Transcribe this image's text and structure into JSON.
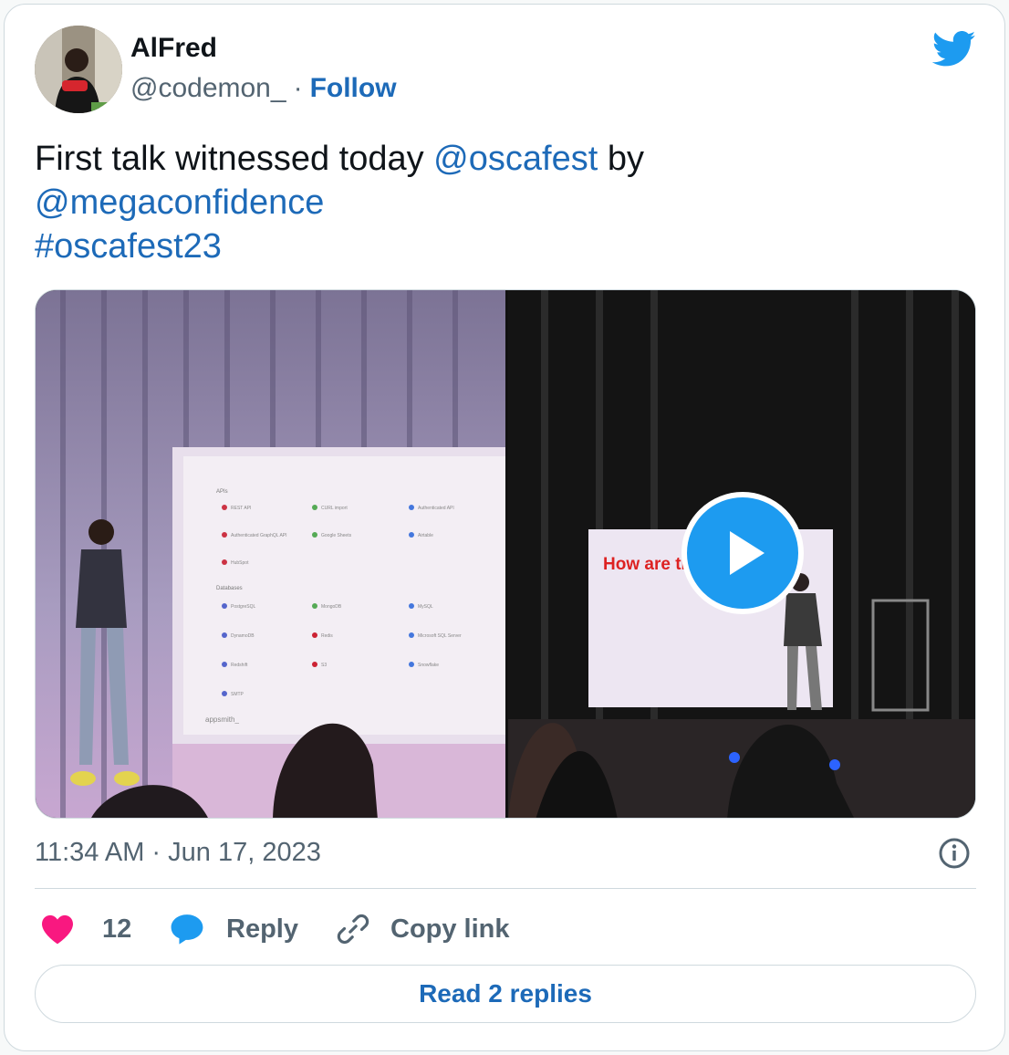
{
  "author": {
    "name": "AlFred",
    "handle": "@codemon_",
    "separator": "·",
    "follow_label": "Follow"
  },
  "tweet": {
    "text_1": "First talk witnessed today ",
    "mention_1": "@oscafest",
    "text_2": " by",
    "mention_2": "@megaconfidence",
    "hashtag": "#oscafest23"
  },
  "media": {
    "left_slide": {
      "section_apis": "APIs",
      "section_databases": "Databases",
      "items": [
        "REST API",
        "CURL import",
        "Authenticated API",
        "Authenticated GraphQL API",
        "Google Sheets",
        "Airtable",
        "HubSpot",
        "PostgreSQL",
        "MongoDB",
        "MySQL",
        "DynamoDB",
        "Redis",
        "Microsoft SQL Server",
        "Redshift",
        "S3",
        "Snowflake",
        "SMTP"
      ],
      "footer": "appsmith_"
    },
    "right_slide": {
      "headline": "How are th"
    },
    "play_icon": "play-icon"
  },
  "meta": {
    "timestamp": "11:34 AM · Jun 17, 2023"
  },
  "actions": {
    "like_count": "12",
    "reply_label": "Reply",
    "copy_link_label": "Copy link"
  },
  "footer": {
    "read_replies_label": "Read 2 replies"
  },
  "colors": {
    "link": "#1d6ab8",
    "twitter_blue": "#1d9bf0",
    "like": "#f91880",
    "muted": "#536471"
  }
}
